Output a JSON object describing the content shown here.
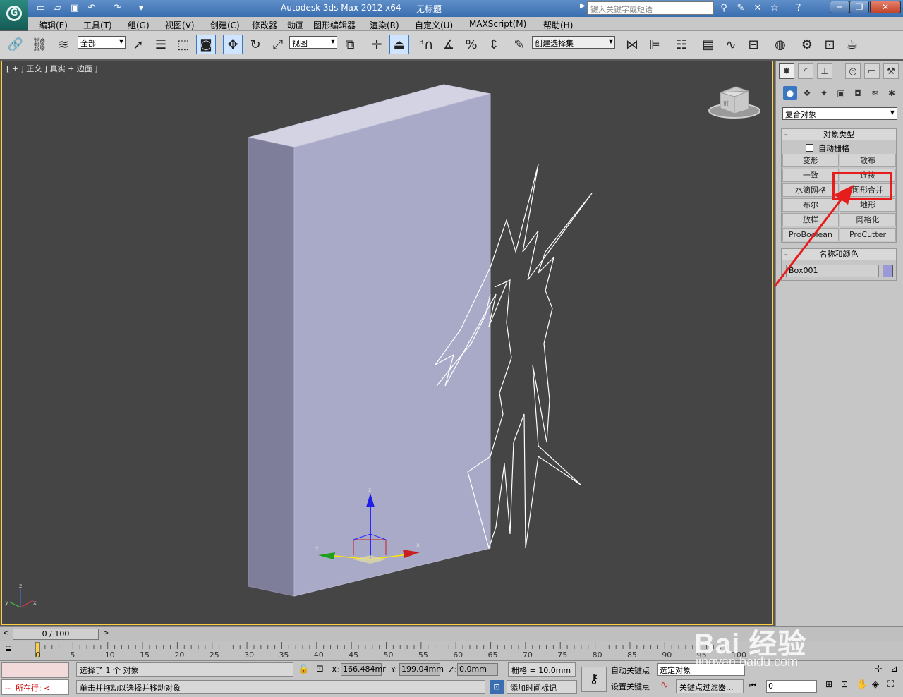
{
  "title_bar": {
    "app_title": "Autodesk 3ds Max  2012 x64",
    "document_title": "无标题",
    "search_placeholder": "键入关键字或短语",
    "quick_access_icons": [
      "new-file-icon",
      "open-folder-icon",
      "save-icon",
      "undo-icon",
      "redo-icon"
    ],
    "window_buttons": [
      "minimize",
      "restore",
      "close"
    ]
  },
  "menu": [
    "编辑(E)",
    "工具(T)",
    "组(G)",
    "视图(V)",
    "创建(C)",
    "修改器",
    "动画",
    "图形编辑器",
    "渲染(R)",
    "自定义(U)",
    "MAXScript(M)",
    "帮助(H)"
  ],
  "toolbar": {
    "selection_filter": "全部",
    "reference_coord": "视图",
    "named_selection": "创建选择集"
  },
  "viewport": {
    "label": "[ + ] 正交 ] 真实 + 边面 ]",
    "object_color": "#a9a9c8",
    "gizmo_axes": [
      "x",
      "y",
      "z"
    ],
    "viewcube_label": "前"
  },
  "command_panel": {
    "category_dropdown": "复合对象",
    "object_type_title": "对象类型",
    "autogrid_label": "自动栅格",
    "buttons": [
      "变形",
      "散布",
      "一致",
      "连接",
      "水滴网格",
      "图形合并",
      "布尔",
      "地形",
      "放样",
      "网格化",
      "ProBoolean",
      "ProCutter"
    ],
    "highlighted_button": "图形合并",
    "name_color_title": "名称和颜色",
    "object_name": "Box001",
    "object_color": "#9a9ad8"
  },
  "time_slider": {
    "frame_display": "0 / 100",
    "ticks": [
      "0",
      "5",
      "10",
      "15",
      "20",
      "25",
      "30",
      "35",
      "40",
      "45",
      "50",
      "55",
      "60",
      "65",
      "70",
      "75",
      "80",
      "85",
      "90",
      "95",
      "100"
    ]
  },
  "status_bar": {
    "selection_status": "选择了 1 个 对象",
    "prompt": "单击并拖动以选择并移动对象",
    "listener_text": "所在行:",
    "x_label": "X:",
    "x_value": "166.484mr",
    "y_label": "Y:",
    "y_value": "199.04mm",
    "z_label": "Z:",
    "z_value": "0.0mm",
    "grid": "栅格 = 10.0mm",
    "add_time_tag": "添加时间标记",
    "auto_key": "自动关键点",
    "set_key": "设置关键点",
    "selected_object": "选定对象",
    "key_filters": "关键点过滤器...",
    "frame_value": "0"
  },
  "watermark": {
    "text": "Bai 经验",
    "url": "jingyan.baidu.com"
  }
}
